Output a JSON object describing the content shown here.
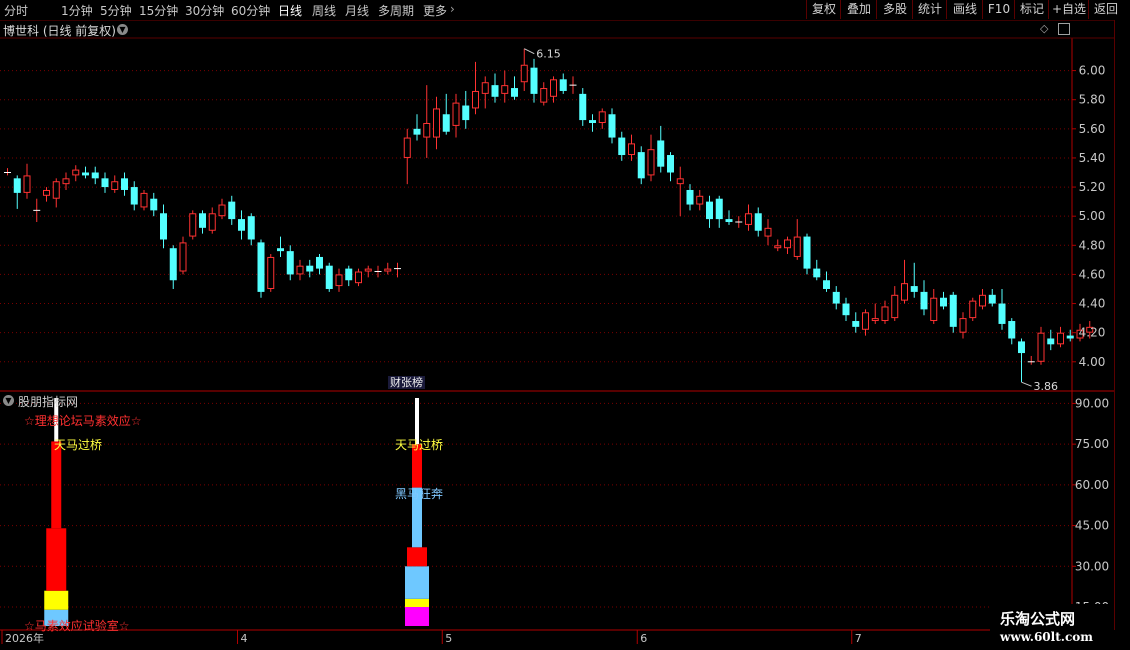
{
  "toolbar": {
    "periods": [
      "分时",
      "1分钟",
      "5分钟",
      "15分钟",
      "30分钟",
      "60分钟",
      "日线",
      "周线",
      "月线",
      "多周期",
      "更多"
    ],
    "active_period": "日线",
    "more_arrow": "›",
    "buttons": [
      "复权",
      "叠加",
      "多股",
      "统计",
      "画线",
      "F10",
      "标记",
      "+自选",
      "返回"
    ]
  },
  "stock_title": "博世科 (日线 前复权)",
  "indicator_title": "股朋指标网",
  "badge": "财张榜",
  "indicator_labels": {
    "top_red": "☆理想论坛马素效应☆",
    "bottom_red": "☆马素效应试验室☆",
    "tianma1": "天马过桥",
    "tianma2": "天马过桥",
    "heima": "黑马狂奔"
  },
  "watermark": {
    "line1": "乐淘公式网",
    "line2": "www.60lt.com"
  },
  "colors": {
    "up": "#ff3232",
    "down": "#54ffff",
    "grid": "#7a0000",
    "axis": "#b0b0b0"
  },
  "chart_data": [
    {
      "type": "candlestick",
      "x_labels": [
        "2026年",
        "4",
        "5",
        "6",
        "7"
      ],
      "y_ticks": [
        "6.00",
        "5.80",
        "5.60",
        "5.40",
        "5.20",
        "5.00",
        "4.80",
        "4.60",
        "4.40",
        "4.20",
        "4.00"
      ],
      "ylim": [
        3.82,
        6.21
      ],
      "high_annotation": "6.15",
      "low_annotation": "3.86",
      "candles": [
        [
          5.3,
          5.33,
          5.28,
          5.3
        ],
        [
          5.26,
          5.28,
          5.05,
          5.16
        ],
        [
          5.16,
          5.36,
          5.12,
          5.28
        ],
        [
          5.04,
          5.12,
          4.96,
          5.04
        ],
        [
          5.14,
          5.2,
          5.1,
          5.18
        ],
        [
          5.12,
          5.26,
          5.06,
          5.24
        ],
        [
          5.22,
          5.3,
          5.18,
          5.26
        ],
        [
          5.28,
          5.35,
          5.24,
          5.32
        ],
        [
          5.3,
          5.34,
          5.26,
          5.28
        ],
        [
          5.3,
          5.34,
          5.22,
          5.26
        ],
        [
          5.26,
          5.3,
          5.16,
          5.2
        ],
        [
          5.18,
          5.28,
          5.16,
          5.24
        ],
        [
          5.26,
          5.3,
          5.14,
          5.18
        ],
        [
          5.2,
          5.24,
          5.04,
          5.08
        ],
        [
          5.06,
          5.18,
          5.04,
          5.16
        ],
        [
          5.12,
          5.16,
          5.0,
          5.04
        ],
        [
          5.02,
          5.08,
          4.78,
          4.84
        ],
        [
          4.78,
          4.8,
          4.5,
          4.56
        ],
        [
          4.62,
          4.86,
          4.6,
          4.82
        ],
        [
          4.86,
          5.04,
          4.84,
          5.02
        ],
        [
          5.02,
          5.04,
          4.88,
          4.92
        ],
        [
          4.9,
          5.06,
          4.88,
          5.02
        ],
        [
          5.0,
          5.12,
          4.98,
          5.08
        ],
        [
          5.1,
          5.14,
          4.94,
          4.98
        ],
        [
          4.98,
          5.04,
          4.84,
          4.9
        ],
        [
          5.0,
          5.02,
          4.8,
          4.84
        ],
        [
          4.82,
          4.84,
          4.44,
          4.48
        ],
        [
          4.5,
          4.74,
          4.48,
          4.72
        ],
        [
          4.78,
          4.86,
          4.72,
          4.76
        ],
        [
          4.76,
          4.8,
          4.56,
          4.6
        ],
        [
          4.6,
          4.7,
          4.56,
          4.66
        ],
        [
          4.66,
          4.7,
          4.58,
          4.62
        ],
        [
          4.72,
          4.74,
          4.6,
          4.64
        ],
        [
          4.66,
          4.68,
          4.48,
          4.5
        ],
        [
          4.52,
          4.64,
          4.48,
          4.6
        ],
        [
          4.64,
          4.66,
          4.52,
          4.56
        ],
        [
          4.54,
          4.64,
          4.52,
          4.62
        ],
        [
          4.62,
          4.66,
          4.58,
          4.64
        ],
        [
          4.62,
          4.66,
          4.58,
          4.62
        ],
        [
          4.62,
          4.68,
          4.6,
          4.64
        ],
        [
          4.64,
          4.68,
          4.58,
          4.64
        ],
        [
          5.4,
          5.6,
          5.22,
          5.54
        ],
        [
          5.6,
          5.7,
          5.52,
          5.56
        ],
        [
          5.54,
          5.9,
          5.4,
          5.64
        ],
        [
          5.54,
          5.82,
          5.46,
          5.74
        ],
        [
          5.7,
          5.84,
          5.56,
          5.58
        ],
        [
          5.62,
          5.84,
          5.54,
          5.78
        ],
        [
          5.76,
          5.86,
          5.6,
          5.66
        ],
        [
          5.74,
          6.06,
          5.7,
          5.86
        ],
        [
          5.84,
          5.96,
          5.74,
          5.92
        ],
        [
          5.9,
          5.98,
          5.78,
          5.82
        ],
        [
          5.84,
          6.0,
          5.78,
          5.9
        ],
        [
          5.88,
          5.96,
          5.8,
          5.82
        ],
        [
          5.92,
          6.15,
          5.86,
          6.04
        ],
        [
          6.02,
          6.08,
          5.78,
          5.84
        ],
        [
          5.78,
          5.92,
          5.76,
          5.88
        ],
        [
          5.82,
          5.96,
          5.78,
          5.94
        ],
        [
          5.94,
          5.98,
          5.84,
          5.86
        ],
        [
          5.9,
          5.96,
          5.84,
          5.9
        ],
        [
          5.84,
          5.88,
          5.62,
          5.66
        ],
        [
          5.66,
          5.7,
          5.58,
          5.64
        ],
        [
          5.64,
          5.74,
          5.6,
          5.72
        ],
        [
          5.7,
          5.74,
          5.5,
          5.54
        ],
        [
          5.54,
          5.58,
          5.38,
          5.42
        ],
        [
          5.42,
          5.56,
          5.38,
          5.5
        ],
        [
          5.44,
          5.48,
          5.22,
          5.26
        ],
        [
          5.28,
          5.56,
          5.24,
          5.46
        ],
        [
          5.52,
          5.62,
          5.3,
          5.34
        ],
        [
          5.42,
          5.44,
          5.24,
          5.3
        ],
        [
          5.22,
          5.34,
          5.0,
          5.26
        ],
        [
          5.18,
          5.22,
          5.04,
          5.08
        ],
        [
          5.08,
          5.18,
          5.04,
          5.14
        ],
        [
          5.1,
          5.14,
          4.92,
          4.98
        ],
        [
          5.12,
          5.14,
          4.92,
          4.98
        ],
        [
          4.98,
          5.04,
          4.94,
          4.96
        ],
        [
          4.96,
          5.0,
          4.92,
          4.96
        ],
        [
          4.94,
          5.08,
          4.9,
          5.02
        ],
        [
          5.02,
          5.06,
          4.86,
          4.9
        ],
        [
          4.86,
          4.98,
          4.8,
          4.92
        ],
        [
          4.78,
          4.84,
          4.76,
          4.8
        ],
        [
          4.78,
          4.86,
          4.74,
          4.84
        ],
        [
          4.72,
          4.98,
          4.7,
          4.86
        ],
        [
          4.86,
          4.88,
          4.6,
          4.64
        ],
        [
          4.64,
          4.7,
          4.56,
          4.58
        ],
        [
          4.56,
          4.62,
          4.48,
          4.5
        ],
        [
          4.48,
          4.52,
          4.36,
          4.4
        ],
        [
          4.4,
          4.44,
          4.28,
          4.32
        ],
        [
          4.28,
          4.34,
          4.2,
          4.24
        ],
        [
          4.22,
          4.36,
          4.18,
          4.34
        ],
        [
          4.28,
          4.4,
          4.26,
          4.3
        ],
        [
          4.28,
          4.42,
          4.26,
          4.38
        ],
        [
          4.3,
          4.52,
          4.28,
          4.46
        ],
        [
          4.42,
          4.7,
          4.4,
          4.54
        ],
        [
          4.52,
          4.68,
          4.44,
          4.48
        ],
        [
          4.48,
          4.56,
          4.32,
          4.36
        ],
        [
          4.28,
          4.5,
          4.26,
          4.44
        ],
        [
          4.44,
          4.48,
          4.36,
          4.38
        ],
        [
          4.46,
          4.48,
          4.2,
          4.24
        ],
        [
          4.2,
          4.34,
          4.16,
          4.3
        ],
        [
          4.3,
          4.44,
          4.28,
          4.42
        ],
        [
          4.38,
          4.5,
          4.36,
          4.46
        ],
        [
          4.46,
          4.5,
          4.38,
          4.4
        ],
        [
          4.4,
          4.5,
          4.22,
          4.26
        ],
        [
          4.28,
          4.3,
          4.12,
          4.16
        ],
        [
          4.14,
          4.16,
          3.86,
          4.06
        ],
        [
          4.0,
          4.04,
          3.98,
          4.0
        ],
        [
          4.0,
          4.24,
          3.98,
          4.2
        ],
        [
          4.16,
          4.22,
          4.08,
          4.12
        ],
        [
          4.12,
          4.24,
          4.1,
          4.2
        ],
        [
          4.18,
          4.22,
          4.14,
          4.16
        ],
        [
          4.16,
          4.26,
          4.14,
          4.22
        ],
        [
          4.2,
          4.28,
          4.16,
          4.24
        ]
      ]
    },
    {
      "type": "bar",
      "ylim": [
        8,
        92
      ],
      "y_ticks": [
        "90.00",
        "75.00",
        "60.00",
        "45.00",
        "30.00",
        "15.00"
      ],
      "stacks": [
        {
          "candle_index": 5,
          "segments": [
            {
              "from": 8,
              "to": 14,
              "color": "#6ec8ff"
            },
            {
              "from": 14,
              "to": 21,
              "color": "#ffff00"
            },
            {
              "from": 21,
              "to": 44,
              "color": "#ff0000"
            },
            {
              "from": 44,
              "to": 76,
              "color": "#ff0000"
            },
            {
              "from": 76,
              "to": 92,
              "color": "#ffffff"
            }
          ]
        },
        {
          "candle_index": 42,
          "segments": [
            {
              "from": 8,
              "to": 15,
              "color": "#ff00ff"
            },
            {
              "from": 15,
              "to": 18,
              "color": "#ffff00"
            },
            {
              "from": 18,
              "to": 30,
              "color": "#6ec8ff"
            },
            {
              "from": 30,
              "to": 37,
              "color": "#ff0000"
            },
            {
              "from": 37,
              "to": 59,
              "color": "#6ec8ff"
            },
            {
              "from": 59,
              "to": 75,
              "color": "#ff0000"
            },
            {
              "from": 75,
              "to": 92,
              "color": "#ffffff"
            }
          ]
        }
      ]
    }
  ]
}
